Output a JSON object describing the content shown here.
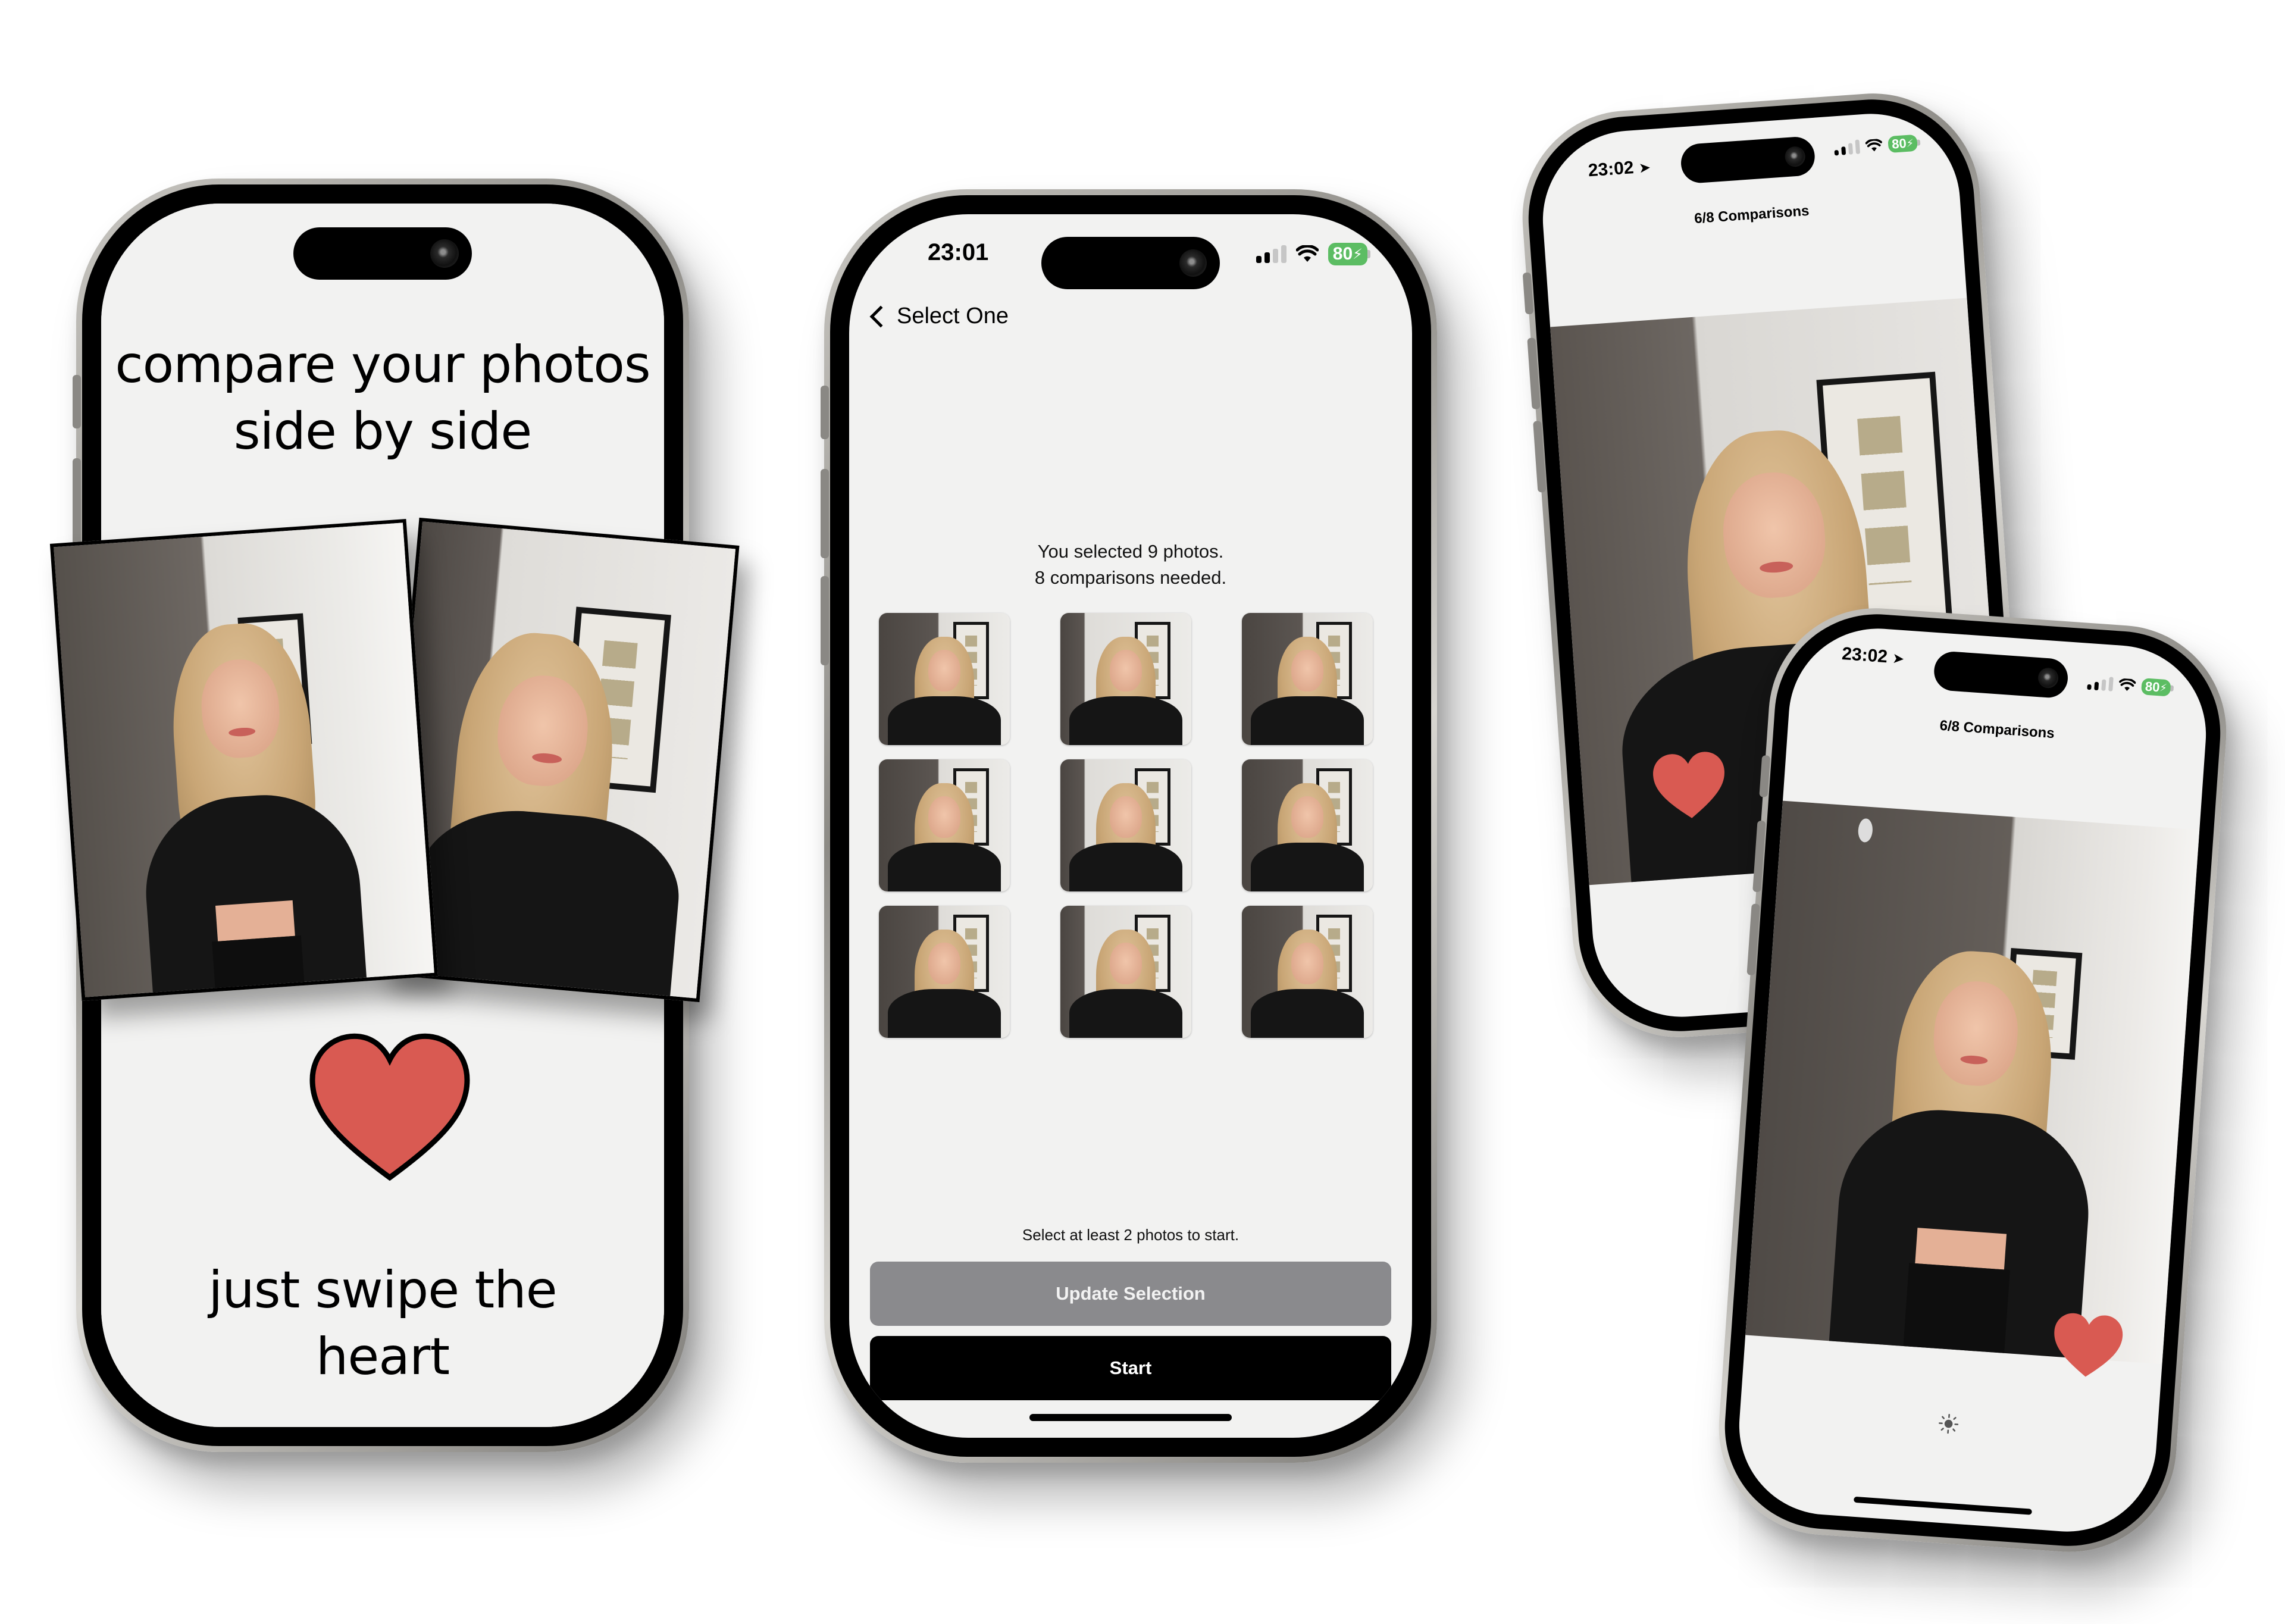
{
  "promo": {
    "headline": "compare your photos side by side",
    "headline_line1": "compare your photos",
    "headline_line2": "side by side",
    "footer_line1": "just swipe the",
    "footer_line2": "heart",
    "heart_color": "#d95a52",
    "heart_outline": "#000000"
  },
  "select_screen": {
    "status": {
      "time": "23:01",
      "battery": "80"
    },
    "nav_back_label": "Select One",
    "summary_line1": "You selected 9 photos.",
    "summary_line2": "8 comparisons needed.",
    "photo_count": 9,
    "thumbnails": [
      {
        "label": "photo-1"
      },
      {
        "label": "photo-2"
      },
      {
        "label": "photo-3"
      },
      {
        "label": "photo-4"
      },
      {
        "label": "photo-5"
      },
      {
        "label": "photo-6"
      },
      {
        "label": "photo-7"
      },
      {
        "label": "photo-8"
      },
      {
        "label": "photo-9"
      }
    ],
    "hint": "Select at least 2 photos to start.",
    "update_button": "Update Selection",
    "start_button": "Start",
    "colors": {
      "update_bg": "#8a8a8d",
      "start_bg": "#000000",
      "battery": "#5cbd63"
    }
  },
  "compare_screens": [
    {
      "status": {
        "time": "23:02",
        "battery": "80"
      },
      "progress_label": "6/8 Comparisons",
      "progress": {
        "current": 6,
        "total": 8
      }
    },
    {
      "status": {
        "time": "23:02",
        "battery": "80"
      },
      "progress_label": "6/8 Comparisons",
      "progress": {
        "current": 6,
        "total": 8
      },
      "bottom_icon": "sun-icon"
    }
  ],
  "icons": {
    "location_arrow": "➤",
    "back_chevron": "chevron-left-icon",
    "heart": "heart-icon",
    "brightness": "sun-icon"
  }
}
